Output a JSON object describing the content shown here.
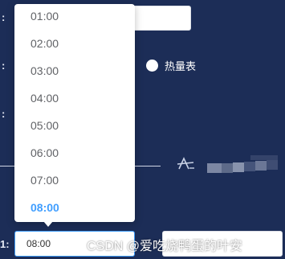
{
  "form": {
    "row_suffix": ":",
    "bottom_row_suffix": "1:"
  },
  "radio": {
    "label": "热量表"
  },
  "time_select": {
    "value": "08:00",
    "options": [
      "01:00",
      "02:00",
      "03:00",
      "04:00",
      "05:00",
      "06:00",
      "07:00",
      "08:00"
    ],
    "selected_index": 7
  },
  "watermark": "CSDN @爱吃烧鸭蛋的叶安",
  "colors": {
    "background": "#1c2d57",
    "accent": "#409eff"
  }
}
